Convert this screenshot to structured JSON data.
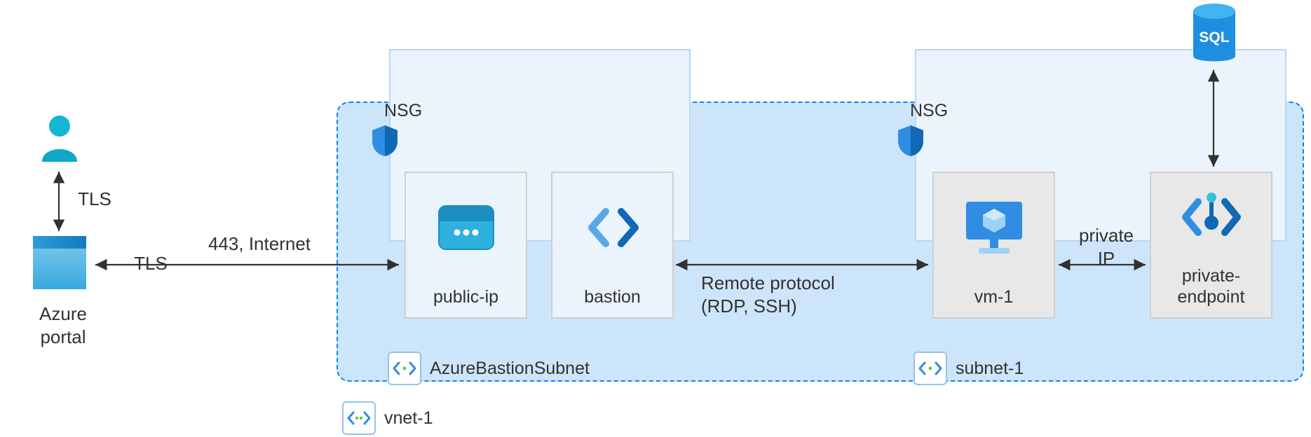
{
  "user": {
    "label_tls_vertical": "TLS"
  },
  "portal": {
    "label": "Azure portal",
    "tls_label": "TLS",
    "internet_label": "443, Internet"
  },
  "vnet": {
    "label": "vnet-1"
  },
  "nsg": {
    "label": "NSG"
  },
  "subnets": {
    "bastion": {
      "label": "AzureBastionSubnet"
    },
    "app": {
      "label": "subnet-1"
    }
  },
  "resources": {
    "public_ip": {
      "label": "public-ip"
    },
    "bastion": {
      "label": "bastion"
    },
    "vm": {
      "label": "vm-1"
    },
    "pe": {
      "label": "private-\nendpoint"
    }
  },
  "edges": {
    "remote_protocol": "Remote protocol\n(RDP, SSH)",
    "private_ip": "private\nIP"
  },
  "external": {
    "sql": "SQL"
  },
  "colors": {
    "azure_blue": "#2f8de4",
    "azure_deep": "#1368b5",
    "teal": "#00b2cc",
    "grey_box": "#e8e8e8",
    "light_box": "#ebf4fd",
    "vnet_bg": "#cde5fa"
  }
}
